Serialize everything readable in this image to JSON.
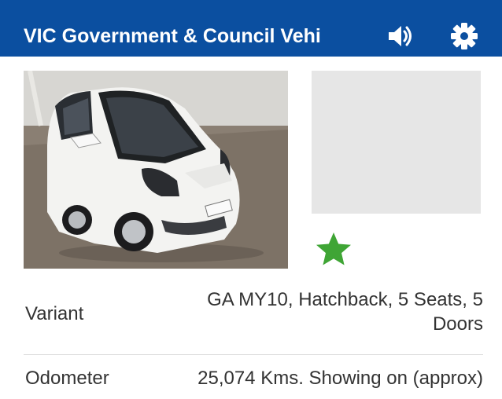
{
  "header": {
    "title": "VIC Government & Council Vehi",
    "background_color": "#0b4fa0",
    "icons": [
      "volume-icon",
      "gear-icon"
    ]
  },
  "listing": {
    "favorite_star_color": "#3fa535",
    "details": [
      {
        "label": "Variant",
        "value": "GA MY10, Hatchback, 5 Seats, 5 Doors"
      },
      {
        "label": "Odometer",
        "value": "25,074 Kms. Showing on (approx)"
      }
    ]
  }
}
